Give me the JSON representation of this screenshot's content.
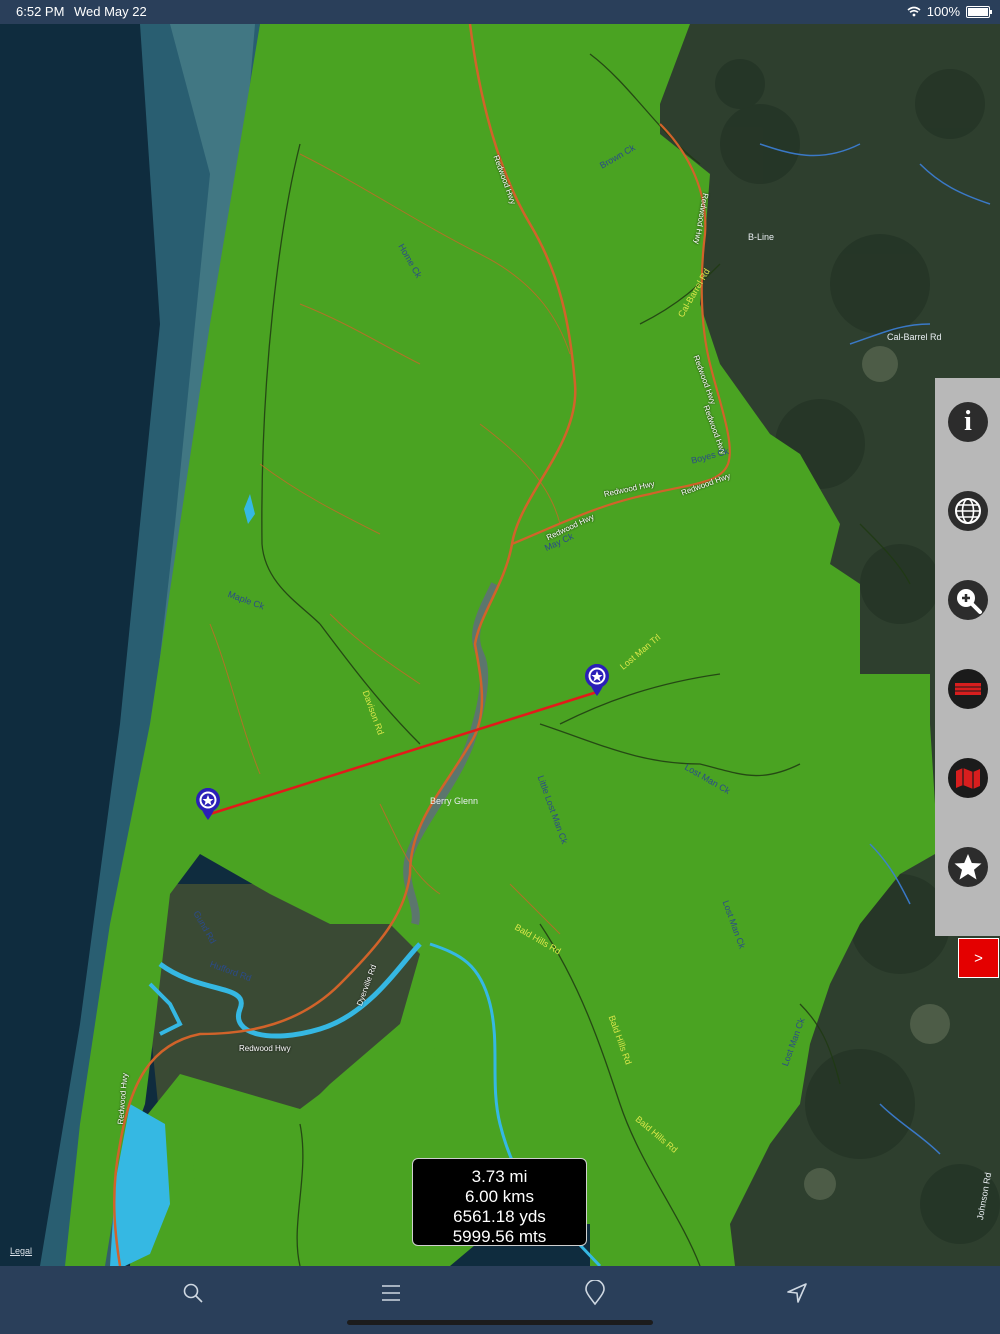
{
  "status_bar": {
    "time": "6:52 PM",
    "date": "Wed May 22",
    "battery": "100%",
    "wifi_icon": "wifi-icon",
    "battery_icon": "battery-icon"
  },
  "map": {
    "labels": {
      "redwood_hwy_1": "Redwood Hwy",
      "redwood_hwy_2": "Redwood Hwy",
      "redwood_hwy_3": "Redwood Hwy",
      "redwood_hwy_4": "Redwood Hwy",
      "redwood_hwy_5": "Redwood Hwy",
      "redwood_hwy_6": "Redwood Hwy",
      "redwood_hwy_7": "Redwood Hwy",
      "redwood_hwy_8": "Redwood Hwy",
      "redwood_hwy_9": "Redwood Hwy",
      "b_line": "B-Line",
      "cal_barrel_rd": "Cal-Barrel Rd",
      "lost_man_trl": "Lost Man Trl",
      "lost_man_ck": "Lost Man Ck",
      "little_lost_man_ck": "Little Lost Man Ck",
      "bald_hills_rd_1": "Bald Hills Rd",
      "bald_hills_rd_2": "Bald Hills Rd",
      "bald_hills_rd_3": "Bald Hills Rd",
      "davison_rd": "Davison Rd",
      "dyerville_rd": "Dyerville Rd",
      "hufford_rd": "Hufford Rd",
      "gund_rd": "Gund Rd",
      "may_ck": "May Ck",
      "boyes_ck": "Boyes Ck",
      "home_ck": "Home Ck",
      "cal_barrel_trail": "Cal-Barrel Rd",
      "maple_ck": "Maple Ck",
      "berry_glenn": "Berry Glenn",
      "brown_ck": "Brown Ck",
      "johnson_rd": "Johnson Rd",
      "lost_man_ck_2": "Lost Man Ck",
      "lost_man_ck_3": "Lost Man Ck"
    },
    "legal": "Legal",
    "colors": {
      "park": "#4aa322",
      "forest": "#2d3e2f",
      "ocean": "#0e2a3a",
      "route": "#e02020",
      "highway": "#d1632a",
      "water": "#3ab8e0",
      "pin": "#2a1fb8"
    },
    "pins": [
      "star-pin-icon",
      "star-pin-icon"
    ]
  },
  "side_panel": {
    "buttons": [
      "info-icon",
      "globe-icon",
      "zoom-in-icon",
      "trail-icon",
      "map-layers-icon",
      "star-icon"
    ],
    "info_glyph": "i",
    "toggle_label": ">"
  },
  "distance": {
    "miles": "3.73 mi",
    "kms": "6.00 kms",
    "yards": "6561.18 yds",
    "meters": "5999.56 mts"
  },
  "tab_bar": {
    "items": [
      "search-icon",
      "menu-icon",
      "location-pin-icon",
      "navigation-arrow-icon"
    ]
  }
}
